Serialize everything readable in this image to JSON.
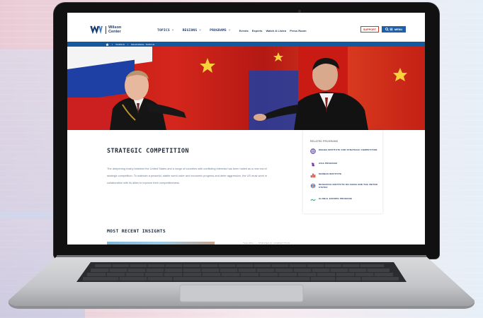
{
  "site": {
    "logo_line1": "Wilson",
    "logo_line2": "Center",
    "nav": [
      {
        "label": "TOPICS ˅"
      },
      {
        "label": "REGIONS ˅"
      },
      {
        "label": "PROGRAMS ˅"
      }
    ],
    "nav_links": [
      "Events",
      "Experts",
      "Watch & Listen",
      "Press Room"
    ],
    "support_label": "SUPPORT",
    "menu_label": "MENU",
    "breadcrumb": [
      "TOPICS",
      "/",
      "SEASONAL TOPICS"
    ]
  },
  "page": {
    "title": "STRATEGIC COMPETITION",
    "body": "The deepening rivalry between the United States and a range of countries with conflicting interests has been hailed as a new era of strategic competition. To maintain a peaceful, stable world order and economic progress and deter aggression, the US must work in collaboration with its allies to improve their competitiveness."
  },
  "related": {
    "title": "RELATED PROGRAMS",
    "items": [
      {
        "label": "WAHBA INSTITUTE FOR STRATEGIC COMPETITION",
        "icon": "globe-icon",
        "color": "#5a3ea8"
      },
      {
        "label": "ASIA PROGRAM",
        "icon": "asia-icon",
        "color": "#7a3aa8"
      },
      {
        "label": "KENNAN INSTITUTE",
        "icon": "kennan-icon",
        "color": "#c0392b"
      },
      {
        "label": "RESEARCH INSTITUTE ON CHINA AND THE UNITED STATES",
        "icon": "china-us-icon",
        "color": "#2a5bb0"
      },
      {
        "label": "GLOBAL EUROPE PROGRAM",
        "icon": "europe-icon",
        "color": "#3aa89a"
      }
    ]
  },
  "insights": {
    "title": "MOST RECENT INSIGHTS",
    "tag": "THE WILL — STRATEGIC COMPETITION"
  },
  "colors": {
    "navy": "#1b3b6f",
    "accent_blue": "#1d5fa8",
    "support_red": "#c0392b"
  }
}
